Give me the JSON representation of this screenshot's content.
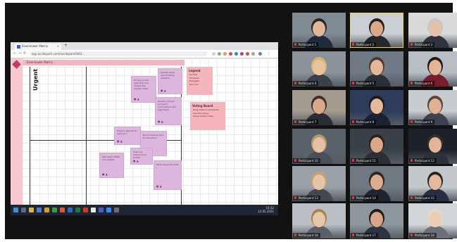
{
  "browser": {
    "tab_title": "Eisenhower Matrix",
    "tab_close": "×",
    "new_tab": "+",
    "url": "app.lucidspark.com/lucidspark/0d1f..."
  },
  "board": {
    "title": "Eisenhower Matrix",
    "axis_label": "Urgent",
    "notes": [
      "Fix bug on the login flow and update the release notes",
      "Update client report before deadline",
      "Review contract and send comments to the legal team",
      "Prepare agenda for next sync",
      "Book meeting room for workshop",
      "Plan team offsite and budget",
      "Write blog post draft",
      "Clean up shared drive folders"
    ],
    "note_footer": "● ▲",
    "legend": {
      "heading": "Legend",
      "items": [
        "Do first",
        "Schedule",
        "Delegate",
        "Don't do"
      ]
    },
    "tips": {
      "heading": "Voting Board",
      "items": [
        "Drag notes to quadrants",
        "Use dot voting",
        "Group similar ideas"
      ]
    }
  },
  "taskbar": {
    "time": "14:32",
    "date": "12.05.2021"
  },
  "participants": [
    {
      "name": "Participant 1",
      "bg": "#7f8a92",
      "skin": "#e0b79b",
      "hair": "#2d2621",
      "shirt": "#1f2a3a"
    },
    {
      "name": "Participant 2",
      "bg": "#c9cfd4",
      "skin": "#d9a98a",
      "hair": "#2a1f1a",
      "shirt": "#23272c"
    },
    {
      "name": "Participant 3",
      "bg": "#d7d9db",
      "skin": "#e6c1a8",
      "hair": "#c7c7c7",
      "shirt": "#2f3340"
    },
    {
      "name": "Participant 4",
      "bg": "#8c9299",
      "skin": "#e8c3a2",
      "hair": "#d8b76a",
      "shirt": "#3a3f4a"
    },
    {
      "name": "Participant 5",
      "bg": "#6f7a85",
      "skin": "#e3b79a",
      "hair": "#4a3a2f",
      "shirt": "#2a2f38"
    },
    {
      "name": "Participant 6",
      "bg": "#b8bec4",
      "skin": "#e2b596",
      "hair": "#1c1a19",
      "shirt": "#7a1e2c"
    },
    {
      "name": "Participant 7",
      "bg": "#a49b8f",
      "skin": "#d9a98a",
      "hair": "#3a3029",
      "shirt": "#2a2d35"
    },
    {
      "name": "Participant 8",
      "bg": "#2e3b5a",
      "skin": "#e4b99d",
      "hair": "#1d1a18",
      "shirt": "#1b2233"
    },
    {
      "name": "Participant 9",
      "bg": "#c7ccd1",
      "skin": "#e1b292",
      "hair": "#5a4637",
      "shirt": "#3d4250"
    },
    {
      "name": "Participant 10",
      "bg": "#5a636c",
      "skin": "#e6c0a3",
      "hair": "#b8965f",
      "shirt": "#4a4f58"
    },
    {
      "name": "Participant 11",
      "bg": "#3a4048",
      "skin": "#d9a98a",
      "hair": "#2a211b",
      "shirt": "#2b2f36"
    },
    {
      "name": "Participant 12",
      "bg": "#1d2129",
      "skin": "#e0b59a",
      "hair": "#3b2f27",
      "shirt": "#2b313b"
    },
    {
      "name": "Participant 13",
      "bg": "#9aa1a8",
      "skin": "#e6c4a8",
      "hair": "#c9a26b",
      "shirt": "#424752"
    },
    {
      "name": "Participant 14",
      "bg": "#707982",
      "skin": "#dcae8f",
      "hair": "#2e2620",
      "shirt": "#1e2530"
    },
    {
      "name": "Participant 15",
      "bg": "#c3c8cd",
      "skin": "#e4b99d",
      "hair": "#2a2420",
      "shirt": "#263042"
    },
    {
      "name": "Participant 16",
      "bg": "#b9bfc5",
      "skin": "#e8c6ab",
      "hair": "#a9814e",
      "shirt": "#5a5f69"
    },
    {
      "name": "Participant 17",
      "bg": "#8e969e",
      "skin": "#d7a68a",
      "hair": "#1f1b19",
      "shirt": "#2d3340"
    },
    {
      "name": "Participant 18",
      "bg": "#d2d6da",
      "skin": "#ecccb4",
      "hair": "#e2d9c8",
      "shirt": "#6b707a"
    }
  ]
}
